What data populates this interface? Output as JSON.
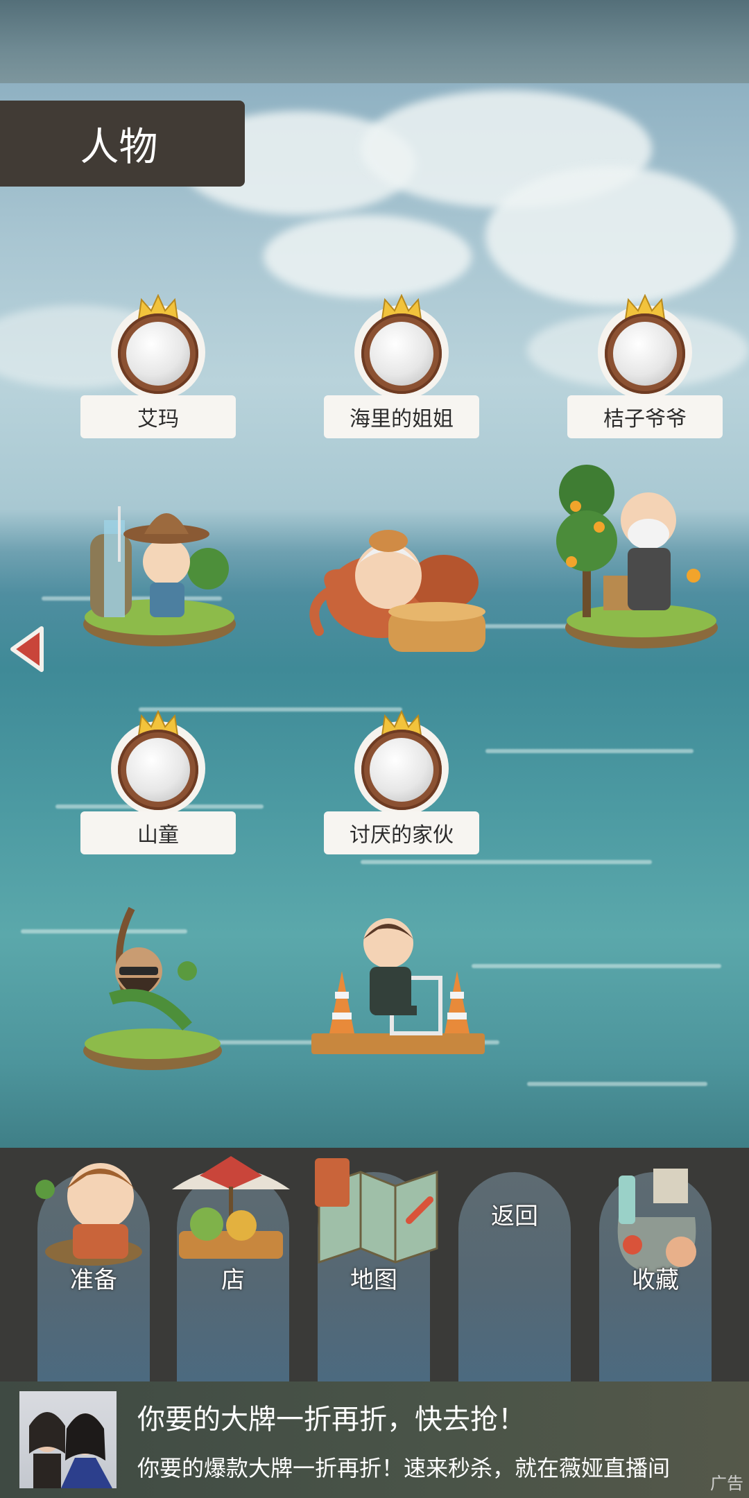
{
  "header": {
    "title": "人物"
  },
  "characters": [
    {
      "name": "艾玛"
    },
    {
      "name": "海里的姐姐"
    },
    {
      "name": "桔子爷爷"
    },
    {
      "name": "山童"
    },
    {
      "name": "讨厌的家伙"
    }
  ],
  "menu": {
    "prepare_label": "准备",
    "shop_label": "店",
    "map_label": "地图",
    "back_label": "返回",
    "collection_label": "收藏"
  },
  "ad": {
    "title": "你要的大牌一折再折，快去抢！",
    "description": "你要的爆款大牌一折再折！速来秒杀，就在薇娅直播间",
    "tag": "广告"
  },
  "colors": {
    "header_bg": "#413b35",
    "medal_ring": "#8b5132",
    "crown_gold": "#f2c33c",
    "arrow_red": "#c9453a",
    "menu_bg": "#3a3a38"
  }
}
